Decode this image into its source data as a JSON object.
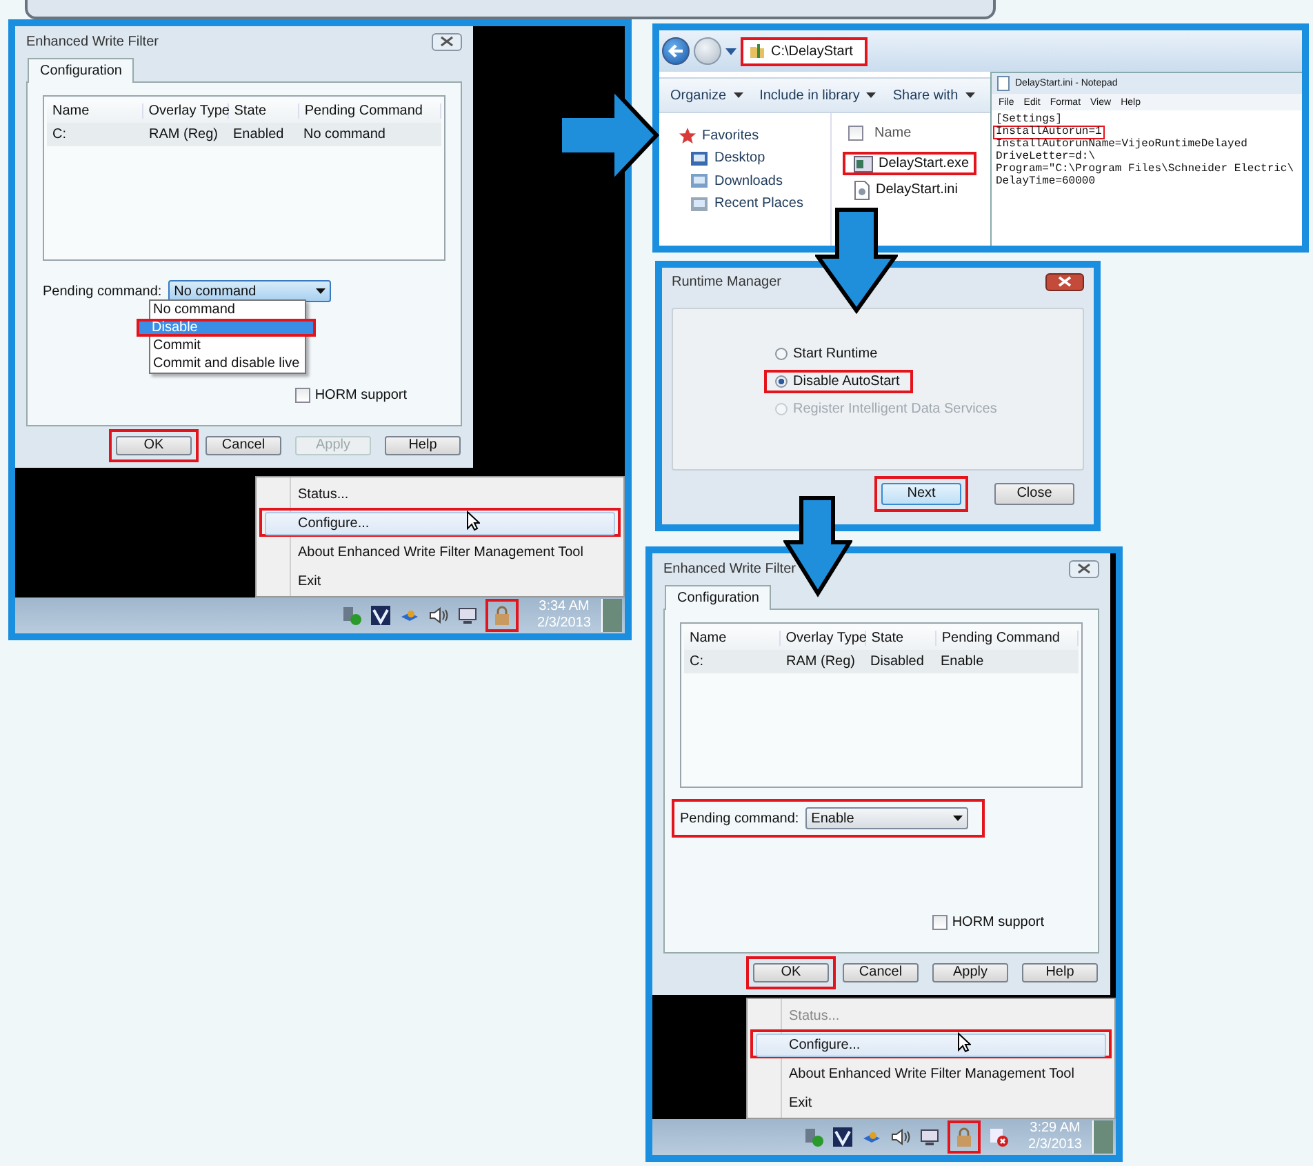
{
  "ewf_dialogs": [
    {
      "title": "Enhanced Write Filter",
      "tab": {
        "label": "Configuration",
        "selected": true
      },
      "columns": [
        "Name",
        "Overlay Type",
        "State",
        "Pending Command"
      ],
      "rows": [
        [
          "C:",
          "RAM (Reg)",
          "Enabled",
          "No command"
        ]
      ],
      "pending": {
        "label": "Pending command:",
        "value": "No command",
        "highlighted": false,
        "open": true
      },
      "options": [
        {
          "label": "No command",
          "selected": false,
          "highlighted": false
        },
        {
          "label": "Disable",
          "selected": true,
          "highlighted": true
        },
        {
          "label": "Commit",
          "selected": false,
          "highlighted": false
        },
        {
          "label": "Commit and disable live",
          "selected": false,
          "highlighted": false
        }
      ],
      "horm": {
        "label": "HORM support",
        "checked": false
      },
      "buttons": [
        {
          "label": "OK",
          "disabled": false,
          "highlighted": true
        },
        {
          "label": "Cancel",
          "disabled": false,
          "highlighted": false
        },
        {
          "label": "Apply",
          "disabled": true,
          "highlighted": false
        },
        {
          "label": "Help",
          "disabled": false,
          "highlighted": false
        }
      ],
      "menu": [
        {
          "label": "Status...",
          "disabled": false,
          "highlighted": false
        },
        {
          "label": "Configure...",
          "disabled": false,
          "highlighted": true
        },
        {
          "label": "About Enhanced Write Filter Management Tool",
          "disabled": false,
          "highlighted": false
        },
        {
          "label": "Exit",
          "disabled": false,
          "highlighted": false
        }
      ],
      "tray": {
        "time": "3:34 AM",
        "date": "2/3/2013",
        "icon_highlighted": true,
        "alert_icon": false
      }
    },
    {
      "title": "Enhanced Write Filter",
      "tab": {
        "label": "Configuration",
        "selected": true
      },
      "columns": [
        "Name",
        "Overlay Type",
        "State",
        "Pending Command"
      ],
      "rows": [
        [
          "C:",
          "RAM (Reg)",
          "Disabled",
          "Enable"
        ]
      ],
      "pending": {
        "label": "Pending command:",
        "value": "Enable",
        "highlighted": true,
        "open": false
      },
      "horm": {
        "label": "HORM support",
        "checked": false
      },
      "buttons": [
        {
          "label": "OK",
          "disabled": false,
          "highlighted": true
        },
        {
          "label": "Cancel",
          "disabled": false,
          "highlighted": false
        },
        {
          "label": "Apply",
          "disabled": false,
          "highlighted": false
        },
        {
          "label": "Help",
          "disabled": false,
          "highlighted": false
        }
      ],
      "menu": [
        {
          "label": "Status...",
          "disabled": true,
          "highlighted": false
        },
        {
          "label": "Configure...",
          "disabled": false,
          "highlighted": true
        },
        {
          "label": "About Enhanced Write Filter Management Tool",
          "disabled": false,
          "highlighted": false
        },
        {
          "label": "Exit",
          "disabled": false,
          "highlighted": false
        }
      ],
      "tray": {
        "time": "3:29 AM",
        "date": "2/3/2013",
        "icon_highlighted": true,
        "alert_icon": true
      }
    }
  ],
  "explorer": {
    "address": {
      "text": "C:\\DelayStart",
      "highlighted": true
    },
    "toolbar": [
      "Organize",
      "Include in library",
      "Share with"
    ],
    "nav": [
      "Favorites",
      "Desktop",
      "Downloads",
      "Recent Places"
    ],
    "column": "Name",
    "checkbox": {
      "checked": false
    },
    "files": [
      {
        "name": "DelayStart.exe",
        "kind": "exe",
        "highlighted": true
      },
      {
        "name": "DelayStart.ini",
        "kind": "ini",
        "highlighted": false
      }
    ]
  },
  "notepad": {
    "title": "DelayStart.ini - Notepad",
    "menu": [
      "File",
      "Edit",
      "Format",
      "View",
      "Help"
    ],
    "lines": [
      {
        "text": "[Settings]",
        "highlighted": false
      },
      {
        "text": "InstallAutorun=1",
        "highlighted": true
      },
      {
        "text": "InstallAutorunName=VijeoRuntimeDelayed",
        "highlighted": false
      },
      {
        "text": "DriveLetter=d:\\",
        "highlighted": false
      },
      {
        "text": "Program=\"C:\\Program Files\\Schneider Electric\\",
        "highlighted": false
      },
      {
        "text": "DelayTime=60000",
        "highlighted": false
      }
    ]
  },
  "runtime_manager": {
    "title": "Runtime Manager",
    "options": [
      {
        "label": "Start Runtime",
        "selected": false,
        "disabled": false,
        "highlighted": false
      },
      {
        "label": "Disable AutoStart",
        "selected": true,
        "disabled": false,
        "highlighted": true
      },
      {
        "label": "Register Intelligent Data Services",
        "selected": false,
        "disabled": true,
        "highlighted": false
      }
    ],
    "buttons": [
      {
        "label": "Next",
        "highlighted": true
      },
      {
        "label": "Close",
        "highlighted": false
      }
    ]
  }
}
